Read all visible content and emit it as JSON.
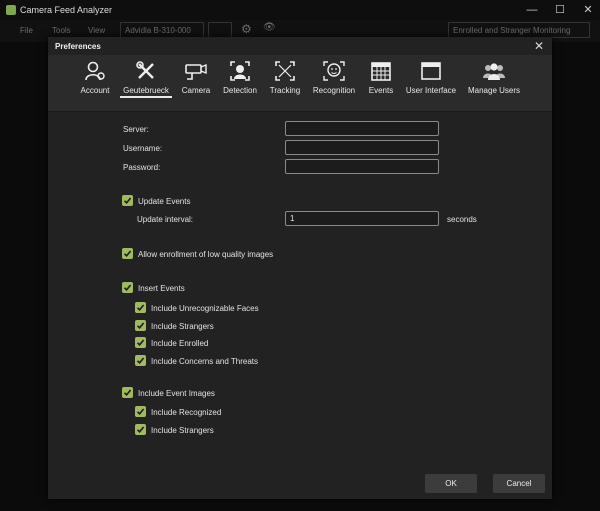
{
  "app": {
    "title": "Camera Feed Analyzer",
    "menu": {
      "file": "File",
      "tools": "Tools",
      "view": "View"
    },
    "camera_select": "Advidia B-310-000",
    "mode_select": "Enrolled and Stranger Monitoring"
  },
  "dialog": {
    "title": "Preferences",
    "tabs": [
      {
        "label": "Account",
        "icon": "account-icon"
      },
      {
        "label": "Geutebrueck",
        "icon": "tools-icon",
        "active": true
      },
      {
        "label": "Camera",
        "icon": "camera-icon"
      },
      {
        "label": "Detection",
        "icon": "detection-icon"
      },
      {
        "label": "Tracking",
        "icon": "tracking-icon"
      },
      {
        "label": "Recognition",
        "icon": "recognition-icon"
      },
      {
        "label": "Events",
        "icon": "calendar-icon"
      },
      {
        "label": "User Interface",
        "icon": "window-icon"
      },
      {
        "label": "Manage Users",
        "icon": "users-icon"
      }
    ],
    "form": {
      "server_label": "Server:",
      "server_value": "",
      "username_label": "Username:",
      "username_value": "",
      "password_label": "Password:",
      "password_value": "",
      "update_events": "Update Events",
      "update_interval_label": "Update interval:",
      "update_interval_value": "1",
      "update_interval_unit": "seconds",
      "allow_low_quality": "Allow enrollment of low quality images",
      "insert_events": "Insert Events",
      "include_unrecognizable": "Include Unrecognizable Faces",
      "include_strangers": "Include Strangers",
      "include_enrolled": "Include Enrolled",
      "include_concerns": "Include Concerns and Threats",
      "include_event_images": "Include Event Images",
      "include_recognized": "Include Recognized",
      "include_strangers_images": "Include Strangers"
    },
    "buttons": {
      "ok": "OK",
      "cancel": "Cancel"
    }
  },
  "colors": {
    "accent_check": "#a0ba62",
    "dialog_bg": "#222222",
    "toolbar_bg": "#2b2b2b"
  }
}
